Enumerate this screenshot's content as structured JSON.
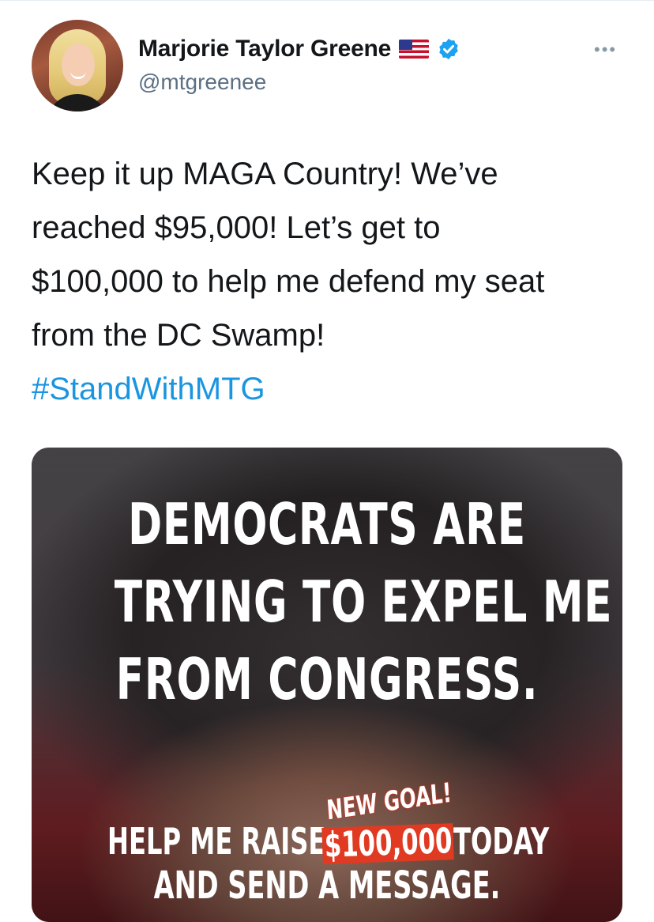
{
  "tweet": {
    "author": {
      "name": "Marjorie Taylor Greene",
      "handle": "@mtgreenee",
      "flag_icon": "us-flag-icon",
      "verified_icon": "verified-badge-icon"
    },
    "more_icon": "more-options-icon",
    "text_lines": [
      "Keep it up MAGA Country! We’ve",
      "reached $95,000! Let’s get to",
      "$100,000 to help me defend my seat",
      "from the DC Swamp!"
    ],
    "hashtag": "#StandWithMTG",
    "media": {
      "headline_lines": [
        "DEMOCRATS ARE",
        "TRYING TO EXPEL ME",
        "FROM CONGRESS."
      ],
      "row1_left": "HELP ME RAISE",
      "goal_label": "NEW GOAL!",
      "goal_amount": "$100,000",
      "row1_right": "TODAY",
      "row2": "AND SEND A MESSAGE."
    }
  },
  "colors": {
    "link": "#1b95e0",
    "secondary_text": "#5b7083",
    "verified": "#1da1f2",
    "goal_box": "#e03b22"
  }
}
